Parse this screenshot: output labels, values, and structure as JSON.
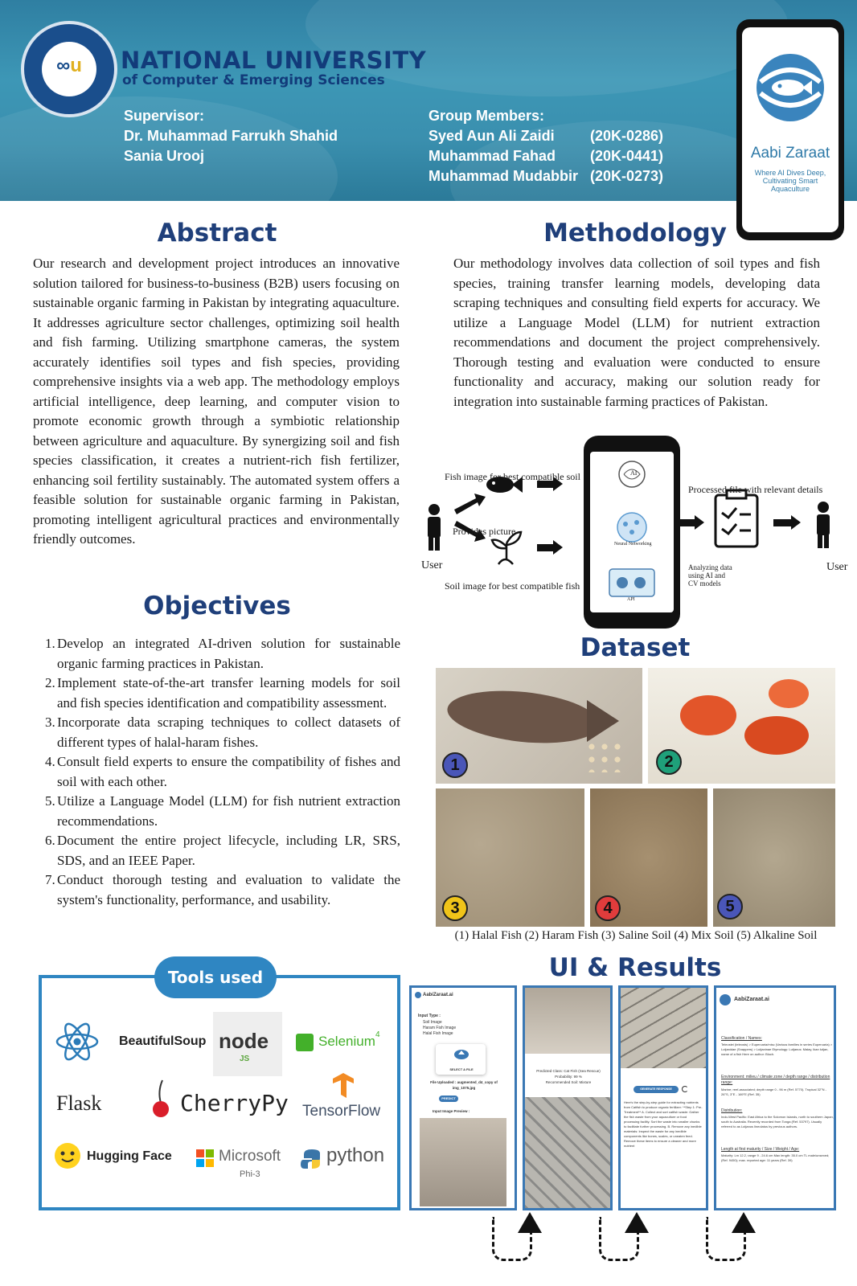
{
  "header": {
    "university_name": "NATIONAL UNIVERSITY",
    "university_sub": "of Computer & Emerging Sciences",
    "supervisor_label": "Supervisor:",
    "supervisors": [
      "Dr. Muhammad Farrukh Shahid",
      "Sania Urooj"
    ],
    "group_label": "Group Members:",
    "members": [
      {
        "name": "Syed Aun Ali Zaidi",
        "id": "(20K-0286)"
      },
      {
        "name": "Muhammad Fahad",
        "id": "(20K-0441)"
      },
      {
        "name": "Muhammad Mudabbir",
        "id": "(20K-0273)"
      }
    ],
    "app_name": "Aabi Zaraat",
    "app_tagline": "Where AI Dives Deep, Cultivating Smart Aquaculture",
    "colors": {
      "banner": "#3a8fae",
      "heading": "#1f3f7a",
      "accent": "#2f86c2"
    }
  },
  "abstract": {
    "title": "Abstract",
    "text": "Our research and development project introduces an innovative solution tailored for business-to-business (B2B) users focusing on sustainable organic farming in Pakistan by integrating aquaculture. It addresses agriculture sector challenges, optimizing soil health and fish farming. Utilizing smartphone cameras, the system accurately identifies soil types and fish species, providing comprehensive insights via a web app. The methodology employs artificial intelligence, deep learning, and computer vision to promote economic growth through a symbiotic relationship between agriculture and aquaculture. By synergizing soil and fish species classification, it creates a nutrient-rich fish fertilizer, enhancing soil fertility sustainably. The automated system offers a feasible solution for sustainable organic farming in Pakistan, promoting intelligent agricultural practices and environmentally friendly outcomes."
  },
  "methodology": {
    "title": "Methodology",
    "text": "Our methodology involves data collection of soil types and fish species, training transfer learning models, developing data scraping techniques and consulting field experts for accuracy. We utilize a Language Model (LLM) for nutrient extraction recommendations and document the project comprehensively. Thorough testing and evaluation were conducted to ensure functionality and accuracy, making our solution ready for integration into sustainable farming practices of Pakistan.",
    "diagram": {
      "user_left": "User",
      "user_right": "User",
      "fish_label": "Fish image for best compatible soil",
      "provides": "Provides picture",
      "soil_label": "Soil image for best compatible fish",
      "ai": "AI",
      "neural": "Neural Networking",
      "api": "API",
      "processed": "Processed file with relevant details",
      "analyzing": "Analyzing data using AI and CV models"
    }
  },
  "objectives": {
    "title": "Objectives",
    "items": [
      "Develop an integrated AI-driven solution for sustainable organic farming practices in Pakistan.",
      "Implement state-of-the-art transfer learning models for soil and fish species identification and compatibility assessment.",
      "Incorporate data scraping techniques to collect datasets of different types of halal-haram fishes.",
      "Consult field experts to ensure the compatibility of fishes and soil with each other.",
      "Utilize a Language Model (LLM) for fish nutrient extraction recommendations.",
      "Document the entire project lifecycle, including LR, SRS, SDS, and an IEEE Paper.",
      "Conduct thorough testing and evaluation to validate the system's functionality, performance, and usability."
    ],
    "numbers": [
      "1.",
      "2.",
      "3.",
      "4.",
      "5.",
      "6.",
      "7."
    ]
  },
  "dataset": {
    "title": "Dataset",
    "badges": [
      "1",
      "2",
      "3",
      "4",
      "5"
    ],
    "caption": "(1) Halal Fish (2) Haram Fish (3) Saline Soil (4) Mix Soil (5) Alkaline Soil"
  },
  "tools": {
    "title": "Tools used",
    "items": [
      "BeautifulSoup",
      "node",
      "JS",
      "Selenium",
      "4",
      "Flask",
      "CherryPy",
      "TensorFlow",
      "Hugging Face",
      "Microsoft",
      "Phi-3",
      "python"
    ]
  },
  "results": {
    "title": "UI & Results",
    "panel1": {
      "brand": "AabiZaraat.ai",
      "input_type": "Input Type :",
      "options": [
        "Soil Image",
        "Haram Fish Image",
        "Halal Fish Image"
      ],
      "select": "SELECT A FILE",
      "uploaded": "File Uploaded : augmented_d4_copy of img_1075.jpg",
      "predict": "PREDICT",
      "preview": "Input Image Preview :"
    },
    "panel2": {
      "predicted": "Predicted Class: Cat Fish (Sea Rescue)",
      "probability": "Probability: 99 %",
      "recommended": "Recommended Soil: Mixture"
    },
    "panel3": {
      "generate": "GENERATE RESPONSE",
      "response": "Here's the step-by-step guide for extracting nutrients from Catfish to produce organic fertilizer: **Step 1: Pre-Treatment** A. Collect and sort catfish waste: Gather the fish waste from your aquaculture or food processing facility. Sort the waste into smaller chunks to facilitate further processing. B. Remove any inedible materials: Inspect the waste for any inedible components like bones, scales, or uneaten feed. Remove these items to ensure a cleaner and more nutrient"
    },
    "panel4": {
      "brand": "AabiZaraat.ai",
      "classification": "Classification / Names:",
      "classification_text": "Teleostei (teleosts) > Eupercaria/misc (Various families in series Eupercaria) > Lutjanidae (Snappers) > Lutjaninae Etymology: Lutjanus: Malay, ikan lutjan, name of a fish Here on author: Bloch.",
      "environment": "Environment: milieu / climate zone / depth range / distribution range:",
      "environment_text": "Marine; reef-associated; depth range 0 - 96 m (Ref. 5770). Tropical 32°N - 26°S, 3°E - 169°E (Ref. 35)",
      "distribution": "Distribution:",
      "distribution_text": "Indo-West Pacific: East Africa to the Solomon Islands, north to southern Japan, south to Australia. Recently recorded from Tonga (Ref. 53797). Usually referred to as Lutjanus lineolatus by previous authors.",
      "length": "Length at first maturity / Size / Weight / Age:",
      "length_text": "Maturity: Lm 12.2, range 9 - 24.6 cm Max length: 35.0 cm TL male/unsexed; (Ref. 9450); max. reported age: 11 years (Ref. 39)"
    }
  }
}
